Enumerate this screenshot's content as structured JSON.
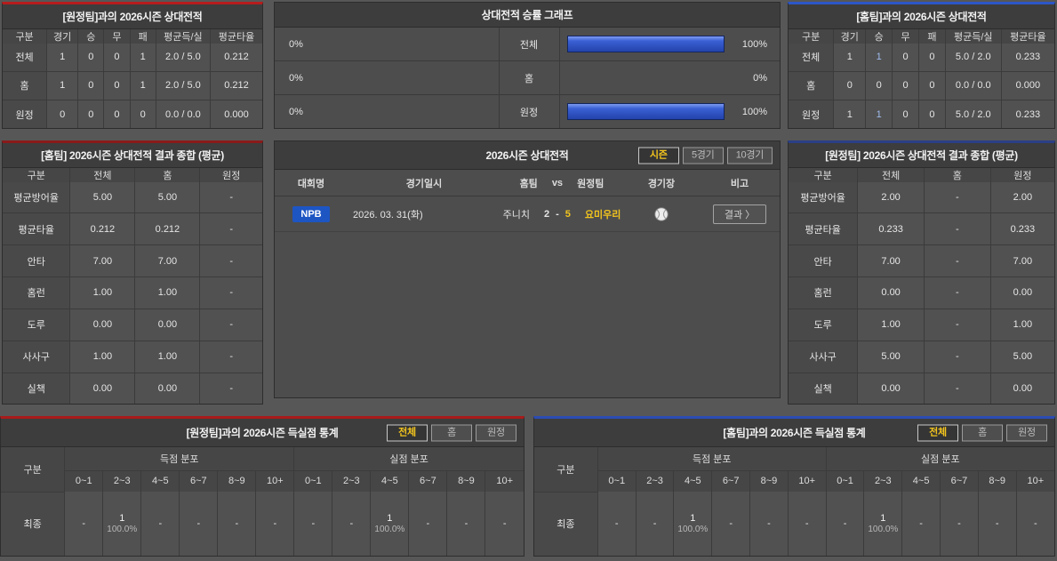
{
  "colors": {
    "accent_red": "#b51d1d",
    "accent_blue": "#2c55c6",
    "active_tab_yellow": "#f2c41d",
    "bar_blue": "#2a50c0",
    "badge_blue": "#1d55c3"
  },
  "record_away": {
    "title": "[원정팀]과의 2026시즌 상대전적",
    "headers": [
      "구분",
      "경기",
      "승",
      "무",
      "패",
      "평균득/실",
      "평균타율"
    ],
    "rows": [
      {
        "label": "전체",
        "cells": [
          "1",
          "0",
          "0",
          "1",
          "2.0 / 5.0",
          "0.212"
        ]
      },
      {
        "label": "홈",
        "cells": [
          "1",
          "0",
          "0",
          "1",
          "2.0 / 5.0",
          "0.212"
        ]
      },
      {
        "label": "원정",
        "cells": [
          "0",
          "0",
          "0",
          "0",
          "0.0 / 0.0",
          "0.000"
        ]
      }
    ]
  },
  "winrate": {
    "title": "상대전적 승률 그래프",
    "rows": [
      {
        "label": "전체",
        "left_pct": "0%",
        "left_value": 0,
        "right_pct": "100%",
        "right_value": 100
      },
      {
        "label": "홈",
        "left_pct": "0%",
        "left_value": 0,
        "right_pct": "0%",
        "right_value": 0
      },
      {
        "label": "원정",
        "left_pct": "0%",
        "left_value": 0,
        "right_pct": "100%",
        "right_value": 100
      }
    ]
  },
  "record_home": {
    "title": "[홈팀]과의 2026시즌 상대전적",
    "headers": [
      "구분",
      "경기",
      "승",
      "무",
      "패",
      "평균득/실",
      "평균타율"
    ],
    "rows": [
      {
        "label": "전체",
        "cells": [
          "1",
          "1",
          "0",
          "0",
          "5.0 / 2.0",
          "0.233"
        ]
      },
      {
        "label": "홈",
        "cells": [
          "0",
          "0",
          "0",
          "0",
          "0.0 / 0.0",
          "0.000"
        ]
      },
      {
        "label": "원정",
        "cells": [
          "1",
          "1",
          "0",
          "0",
          "5.0 / 2.0",
          "0.233"
        ]
      }
    ]
  },
  "summary_home": {
    "title": "[홈팀] 2026시즌 상대전적 결과 종합 (평균)",
    "headers": [
      "구분",
      "전체",
      "홈",
      "원정"
    ],
    "rows": [
      {
        "label": "평균방어율",
        "cells": [
          "5.00",
          "5.00",
          "-"
        ]
      },
      {
        "label": "평균타율",
        "cells": [
          "0.212",
          "0.212",
          "-"
        ]
      },
      {
        "label": "안타",
        "cells": [
          "7.00",
          "7.00",
          "-"
        ]
      },
      {
        "label": "홈런",
        "cells": [
          "1.00",
          "1.00",
          "-"
        ]
      },
      {
        "label": "도루",
        "cells": [
          "0.00",
          "0.00",
          "-"
        ]
      },
      {
        "label": "사사구",
        "cells": [
          "1.00",
          "1.00",
          "-"
        ]
      },
      {
        "label": "실책",
        "cells": [
          "0.00",
          "0.00",
          "-"
        ]
      }
    ]
  },
  "season": {
    "title": "2026시즌 상대전적",
    "tabs": [
      {
        "label": "시즌",
        "active": true
      },
      {
        "label": "5경기",
        "active": false
      },
      {
        "label": "10경기",
        "active": false
      }
    ],
    "headers": {
      "league": "대회명",
      "datetime": "경기일시",
      "home": "홈팀",
      "vs": "vs",
      "away": "원정팀",
      "venue": "경기장",
      "note": "비고"
    },
    "match": {
      "league": "NPB",
      "datetime": "2026. 03. 31(화)",
      "home_team": "주니치",
      "home_score": "2",
      "score_sep": "-",
      "away_score": "5",
      "away_team": "요미우리",
      "result_label": "결과 〉"
    }
  },
  "summary_away": {
    "title": "[원정팀] 2026시즌 상대전적 결과 종합 (평균)",
    "headers": [
      "구분",
      "전체",
      "홈",
      "원정"
    ],
    "rows": [
      {
        "label": "평균방어율",
        "cells": [
          "2.00",
          "-",
          "2.00"
        ]
      },
      {
        "label": "평균타율",
        "cells": [
          "0.233",
          "-",
          "0.233"
        ]
      },
      {
        "label": "안타",
        "cells": [
          "7.00",
          "-",
          "7.00"
        ]
      },
      {
        "label": "홈런",
        "cells": [
          "0.00",
          "-",
          "0.00"
        ]
      },
      {
        "label": "도루",
        "cells": [
          "1.00",
          "-",
          "1.00"
        ]
      },
      {
        "label": "사사구",
        "cells": [
          "5.00",
          "-",
          "5.00"
        ]
      },
      {
        "label": "실책",
        "cells": [
          "0.00",
          "-",
          "0.00"
        ]
      }
    ]
  },
  "scoring_away": {
    "title": "[원정팀]과의 2026시즌 득실점 통계",
    "tabs": [
      {
        "label": "전체",
        "active": true
      },
      {
        "label": "홈",
        "active": false
      },
      {
        "label": "원정",
        "active": false
      }
    ],
    "col_label": "구분",
    "groups": [
      "득점 분포",
      "실점 분포"
    ],
    "bins": [
      "0~1",
      "2~3",
      "4~5",
      "6~7",
      "8~9",
      "10+"
    ],
    "row_label": "최종",
    "empty": "-",
    "scored": [
      "-",
      {
        "count": "1",
        "pct": "100.0%"
      },
      "-",
      "-",
      "-",
      "-"
    ],
    "conceded": [
      "-",
      "-",
      {
        "count": "1",
        "pct": "100.0%"
      },
      "-",
      "-",
      "-"
    ]
  },
  "scoring_home": {
    "title": "[홈팀]과의 2026시즌 득실점 통계",
    "tabs": [
      {
        "label": "전체",
        "active": true
      },
      {
        "label": "홈",
        "active": false
      },
      {
        "label": "원정",
        "active": false
      }
    ],
    "col_label": "구분",
    "groups": [
      "득점 분포",
      "실점 분포"
    ],
    "bins": [
      "0~1",
      "2~3",
      "4~5",
      "6~7",
      "8~9",
      "10+"
    ],
    "row_label": "최종",
    "empty": "-",
    "scored": [
      "-",
      "-",
      {
        "count": "1",
        "pct": "100.0%"
      },
      "-",
      "-",
      "-"
    ],
    "conceded": [
      "-",
      {
        "count": "1",
        "pct": "100.0%"
      },
      "-",
      "-",
      "-",
      "-"
    ]
  }
}
